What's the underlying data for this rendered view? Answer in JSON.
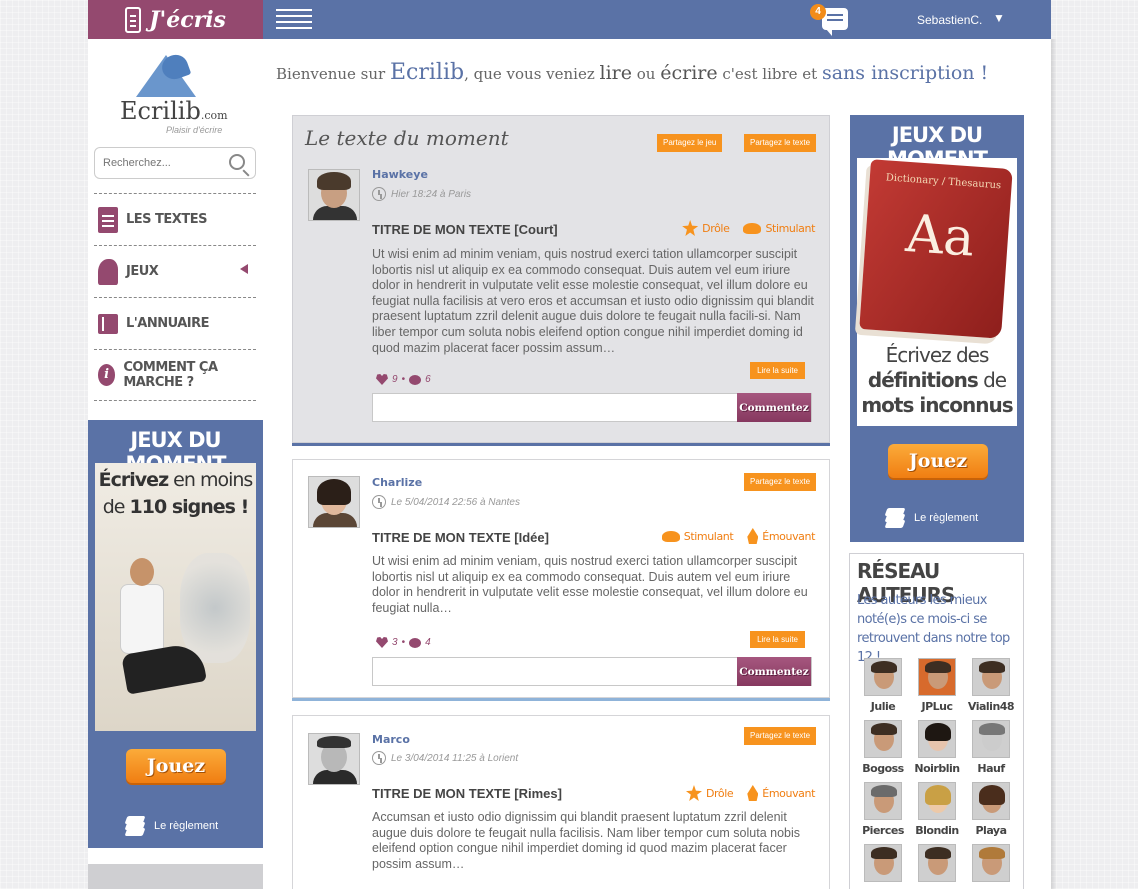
{
  "header": {
    "brand_label": "J'écris",
    "notification_count": "4",
    "user_name": "SebastienC.",
    "user_caret": "▼"
  },
  "logo": {
    "wordmark": "Ecrilib",
    "domain": ".com",
    "tagline": "Plaisir d'écrire"
  },
  "search": {
    "placeholder": "Recherchez..."
  },
  "nav": {
    "items": [
      {
        "label": "LES TEXTES",
        "icon": "document-icon"
      },
      {
        "label": "JEUX",
        "icon": "chess-knight-icon"
      },
      {
        "label": "L'ANNUAIRE",
        "icon": "address-book-icon"
      },
      {
        "label": "COMMENT ÇA MARCHE ?",
        "icon": "info-icon"
      }
    ]
  },
  "left_promo": {
    "title": "JEUX DU MOMENT",
    "line1_bold": "Écrivez",
    "line1_rest": " en moins",
    "line2_pre": "de ",
    "line2_bold": "110 signes !",
    "play_label": "Jouez",
    "rules_label": "Le règlement"
  },
  "welcome": {
    "part1": "Bienvenue sur ",
    "brand": "Ecrilib",
    "part2": ", que vous veniez ",
    "lire": "lire",
    "part3": " ou ",
    "ecrire": "écrire",
    "part4": " c'est libre et ",
    "sans": "sans inscription !"
  },
  "posts": [
    {
      "heading": "Le texte du moment",
      "share_game": "Partagez le jeu",
      "share_text": "Partagez le texte",
      "author": "Hawkeye",
      "date": "Hier 18:24 à Paris",
      "title": "TITRE DE MON TEXTE [Court]",
      "tags": [
        "Drôle",
        "Stimulant"
      ],
      "body": "Ut wisi enim ad minim veniam, quis nostrud exerci tation ullamcorper suscipit lobortis nisl ut aliquip ex ea commodo consequat. Duis autem vel eum iriure dolor in hendrerit in vulputate velit esse molestie consequat, vel illum dolore eu feugiat nulla facilisis at vero eros et accumsan et iusto odio dignissim qui blandit praesent luptatum zzril delenit augue duis dolore te feugait nulla facili-si. Nam liber tempor cum soluta nobis eleifend option congue nihil imperdiet doming id quod mazim placerat facer possim assum…",
      "read_more": "Lire la suite",
      "likes": "9",
      "comments": "6",
      "comment_button": "Commentez"
    },
    {
      "share_text": "Partagez le texte",
      "author": "Charlize",
      "date": "Le 5/04/2014 22:56 à Nantes",
      "title": "TITRE DE MON TEXTE [Idée]",
      "tags": [
        "Stimulant",
        "Émouvant"
      ],
      "body": "Ut wisi enim ad minim veniam, quis nostrud exerci tation ullamcorper suscipit lobortis nisl ut aliquip ex ea commodo consequat. Duis autem vel eum iriure dolor in hendrerit in vulputate velit esse molestie consequat, vel illum dolore eu feugiat nulla…",
      "read_more": "Lire la suite",
      "likes": "3",
      "comments": "4",
      "comment_button": "Commentez"
    },
    {
      "share_text": "Partagez le texte",
      "author": "Marco",
      "date": "Le 3/04/2014 11:25 à Lorient",
      "title": "TITRE DE MON TEXTE [Rimes]",
      "tags": [
        "Drôle",
        "Émouvant"
      ],
      "body": "Accumsan et iusto odio dignissim qui blandit praesent luptatum zzril delenit augue duis dolore te feugait nulla facilisis. Nam liber tempor cum soluta nobis eleifend option congue nihil imperdiet doming id quod mazim placerat facer possim assum…"
    }
  ],
  "right_promo": {
    "title": "JEUX DU MOMENT",
    "book_label": "Dictionary / Thesaurus",
    "book_letters": "Aa",
    "line1": "Écrivez des",
    "line2_bold": "définitions",
    "line2_rest": " de",
    "line3_bold": "mots inconnus",
    "play_label": "Jouez",
    "rules_label": "Le règlement"
  },
  "authors": {
    "title": "RÉSEAU AUTEURS",
    "subtitle": "Les auteurs les mieux noté(e)s ce mois-ci se retrouvent dans notre top 12 !",
    "list": [
      "Julie",
      "JPLuc",
      "Vialin48",
      "Bogoss",
      "Noirblin",
      "Hauf",
      "Pierces",
      "Blondin",
      "Playa",
      "",
      "",
      ""
    ]
  }
}
